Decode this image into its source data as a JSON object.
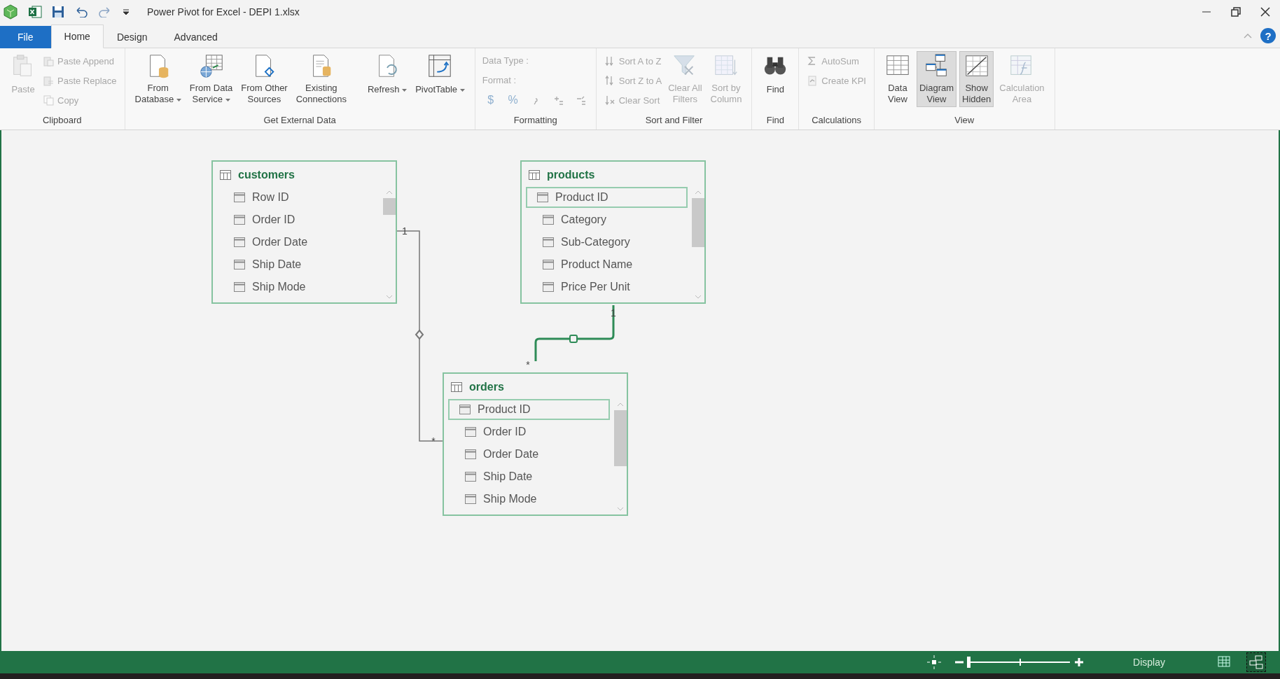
{
  "window": {
    "title": "Power Pivot for Excel - DEPI 1.xlsx"
  },
  "tabs": [
    {
      "label": "File",
      "kind": "file",
      "selected": false
    },
    {
      "label": "Home",
      "kind": "tab",
      "selected": true
    },
    {
      "label": "Design",
      "kind": "tab",
      "selected": false
    },
    {
      "label": "Advanced",
      "kind": "tab",
      "selected": false
    }
  ],
  "help": "?",
  "ribbon": {
    "groups": [
      {
        "label": "Clipboard",
        "controls": [
          {
            "kind": "large",
            "label_lines": [
              "Paste"
            ],
            "disabled": true
          },
          {
            "kind": "stack",
            "items": [
              {
                "label": "Paste Append",
                "disabled": true
              },
              {
                "label": "Paste Replace",
                "disabled": true
              },
              {
                "label": "Copy",
                "disabled": true
              }
            ]
          }
        ]
      },
      {
        "label": "Get External Data",
        "controls": [
          {
            "kind": "large",
            "label_lines": [
              "From",
              "Database"
            ],
            "dropdown": true,
            "disabled": false
          },
          {
            "kind": "large",
            "label_lines": [
              "From Data",
              "Service"
            ],
            "dropdown": true,
            "disabled": false
          },
          {
            "kind": "large",
            "label_lines": [
              "From Other",
              "Sources"
            ],
            "disabled": false
          },
          {
            "kind": "large",
            "label_lines": [
              "Existing",
              "Connections"
            ],
            "disabled": false
          },
          {
            "kind": "spacer"
          },
          {
            "kind": "large",
            "label_lines": [
              "Refresh"
            ],
            "dropdown": true,
            "disabled": false
          },
          {
            "kind": "large",
            "label_lines": [
              "PivotTable"
            ],
            "dropdown": true,
            "disabled": false
          }
        ]
      },
      {
        "label": "Formatting",
        "controls": [
          {
            "kind": "format",
            "fields": [
              {
                "label": "Data Type :",
                "disabled": true
              },
              {
                "label": "Format :",
                "disabled": true
              }
            ],
            "buttons": [
              {
                "text": "$",
                "disabled": true
              },
              {
                "text": "%",
                "disabled": true
              },
              {
                "disabled": true
              },
              {
                "disabled": true
              },
              {
                "disabled": true
              }
            ]
          }
        ]
      },
      {
        "label": "Sort and Filter",
        "controls": [
          {
            "kind": "stack",
            "items": [
              {
                "label": "Sort A to Z",
                "disabled": true
              },
              {
                "label": "Sort Z to A",
                "disabled": true
              },
              {
                "label": "Clear Sort",
                "disabled": true
              }
            ]
          },
          {
            "kind": "large",
            "label_lines": [
              "Clear All",
              "Filters"
            ],
            "disabled": true
          },
          {
            "kind": "large",
            "label_lines": [
              "Sort by",
              "Column"
            ],
            "disabled": true
          }
        ]
      },
      {
        "label": "Find",
        "controls": [
          {
            "kind": "large",
            "label_lines": [
              "Find"
            ],
            "disabled": false
          }
        ]
      },
      {
        "label": "Calculations",
        "controls": [
          {
            "kind": "stack",
            "items": [
              {
                "label": "AutoSum",
                "disabled": true
              },
              {
                "label": "Create KPI",
                "disabled": true
              }
            ]
          }
        ]
      },
      {
        "label": "View",
        "controls": [
          {
            "kind": "large",
            "label_lines": [
              "Data",
              "View"
            ],
            "disabled": false,
            "selected": false
          },
          {
            "kind": "large",
            "label_lines": [
              "Diagram",
              "View"
            ],
            "disabled": false,
            "selected": true
          },
          {
            "kind": "large",
            "label_lines": [
              "Show",
              "Hidden"
            ],
            "disabled": false,
            "selected": true
          },
          {
            "kind": "large",
            "label_lines": [
              "Calculation",
              "Area"
            ],
            "disabled": true,
            "selected": false
          }
        ]
      }
    ]
  },
  "diagram": {
    "tables": [
      {
        "name": "customers",
        "columns": [
          {
            "name": "Row ID",
            "selected": false
          },
          {
            "name": "Order ID",
            "selected": false
          },
          {
            "name": "Order Date",
            "selected": false
          },
          {
            "name": "Ship Date",
            "selected": false
          },
          {
            "name": "Ship Mode",
            "selected": false
          }
        ]
      },
      {
        "name": "products",
        "columns": [
          {
            "name": "Product ID",
            "selected": true
          },
          {
            "name": "Category",
            "selected": false
          },
          {
            "name": "Sub-Category",
            "selected": false
          },
          {
            "name": "Product Name",
            "selected": false
          },
          {
            "name": "Price Per Unit",
            "selected": false
          }
        ]
      },
      {
        "name": "orders",
        "columns": [
          {
            "name": "Product ID",
            "selected": true
          },
          {
            "name": "Order ID",
            "selected": false
          },
          {
            "name": "Order Date",
            "selected": false
          },
          {
            "name": "Ship Date",
            "selected": false
          },
          {
            "name": "Ship Mode",
            "selected": false
          }
        ]
      }
    ],
    "relationships": [
      {
        "from_label": "1",
        "to_label": "*",
        "selected": false
      },
      {
        "from_label": "1",
        "to_label": "*",
        "selected": true
      }
    ]
  },
  "status_bar": {
    "zoom": {
      "level": 0
    },
    "display": "Display",
    "views": [
      {
        "kind": "grid",
        "selected": false
      },
      {
        "kind": "diagram",
        "selected": true
      }
    ]
  }
}
